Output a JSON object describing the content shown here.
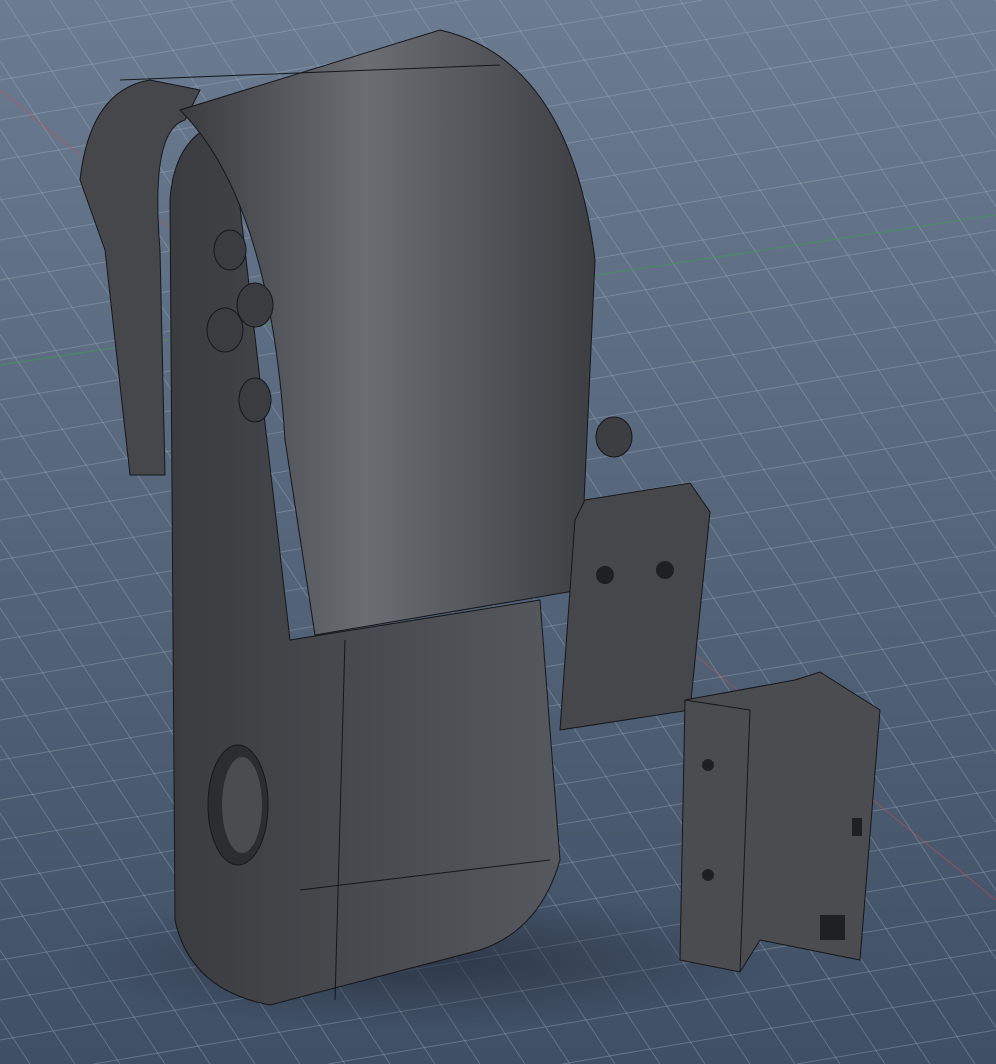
{
  "viewport": {
    "background_top": "#6b7c91",
    "background_bottom": "#3f4f64",
    "grid_color": "#aab6c6",
    "axis_red": "#c05050",
    "axis_green": "#3f9a52"
  },
  "model": {
    "body_color": "#4a4c50",
    "body_light": "#6a6d72",
    "body_dark": "#2b2d30",
    "edge_color": "#15171a",
    "parts": [
      "hook-arm",
      "main-body",
      "lid-cover",
      "bracket-plate",
      "clip-block",
      "knob"
    ]
  }
}
